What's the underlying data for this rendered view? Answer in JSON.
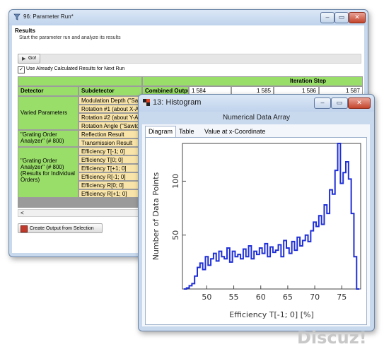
{
  "param_window": {
    "title": "96: Parameter Run*",
    "section": "Results",
    "description": "Start the parameter run and analyze its results",
    "go_label": "Go!",
    "checkbox_label": "Use Already Calculated Results for Next Run",
    "checkbox_checked": true,
    "iteration_header": "Iteration Step",
    "col_detector": "Detector",
    "col_subdetector": "Subdetector",
    "col_combined": "Combined Output",
    "iterations": [
      "1 584",
      "1 585",
      "1 586",
      "1 587"
    ],
    "group1_label": "Varied Parameters",
    "group1_rows": [
      "Modulation Depth (\"Sawto",
      "Rotation #1 (about X-Axis",
      "Rotation #2 (about Y-Axis",
      "Rotation Angle (\"Sawtoot"
    ],
    "group2_label": "\"Grating Order Analyzer\" (# 800)",
    "group2_rows": [
      "Reflection Result",
      "Transmission Result"
    ],
    "group3_label": "\"Grating Order Analyzer\" (# 800) (Results for Individual Orders)",
    "group3_rows": [
      "Efficiency T[-1; 0]",
      "Efficiency T[0; 0]",
      "Efficiency T[+1; 0]",
      "Efficiency R[-1; 0]",
      "Efficiency R[0; 0]",
      "Efficiency R[+1; 0]"
    ],
    "scroll_left": "<",
    "output_button": "Create Output from Selection"
  },
  "hist_window": {
    "title": "13: Histogram",
    "subtitle": "Numerical Data Array",
    "tabs": [
      "Diagram",
      "Table",
      "Value at x-Coordinate"
    ],
    "active_tab": "Diagram"
  },
  "watermark": "Discuz!",
  "colors": {
    "green": "#9ade6a",
    "yellow": "#f8e4a8",
    "series": "#1f2fd6"
  },
  "chart_data": {
    "type": "line",
    "title": "",
    "xlabel": "Efficiency T[-1; 0] [%]",
    "ylabel": "Number of Data Points",
    "xlim": [
      45.5,
      78.5
    ],
    "ylim": [
      0,
      135
    ],
    "xticks": [
      "50",
      "55",
      "60",
      "65",
      "70",
      "75"
    ],
    "yticks": [
      "50",
      "100"
    ],
    "series": [
      {
        "values_x": [
          46,
          46.5,
          47,
          47.5,
          48,
          48.5,
          49,
          49.5,
          50,
          50.5,
          51,
          51.5,
          52,
          52.5,
          53,
          53.5,
          54,
          54.5,
          55,
          55.5,
          56,
          56.5,
          57,
          57.5,
          58,
          58.5,
          59,
          59.5,
          60,
          60.5,
          61,
          61.5,
          62,
          62.5,
          63,
          63.5,
          64,
          64.5,
          65,
          65.5,
          66,
          66.5,
          67,
          67.5,
          68,
          68.5,
          69,
          69.5,
          70,
          70.5,
          71,
          71.5,
          72,
          72.5,
          73,
          73.5,
          74,
          74.5,
          75,
          75.5,
          76,
          76.5,
          77,
          77.5,
          78
        ],
        "values_y": [
          0,
          1,
          3,
          5,
          12,
          20,
          24,
          18,
          30,
          22,
          28,
          33,
          26,
          35,
          30,
          28,
          38,
          25,
          35,
          30,
          32,
          28,
          37,
          30,
          40,
          28,
          35,
          32,
          38,
          33,
          42,
          30,
          39,
          34,
          36,
          41,
          30,
          45,
          38,
          33,
          44,
          36,
          48,
          40,
          45,
          50,
          44,
          54,
          62,
          58,
          68,
          60,
          78,
          70,
          92,
          88,
          110,
          136,
          98,
          108,
          118,
          102,
          70,
          30,
          0
        ]
      }
    ]
  }
}
